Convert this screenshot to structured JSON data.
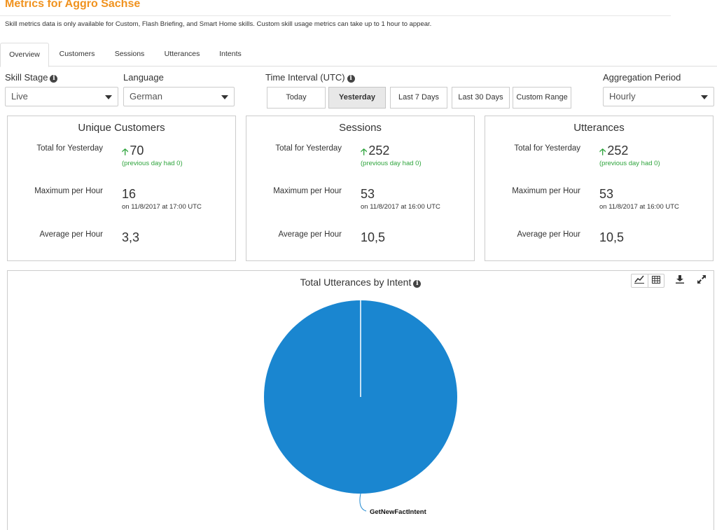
{
  "header": {
    "title": "Metrics for Aggro Sachse",
    "notice": "Skill metrics data is only available for Custom, Flash Briefing, and Smart Home skills. Custom skill usage metrics can take up to 1 hour to appear."
  },
  "tabs": [
    {
      "label": "Overview",
      "active": true
    },
    {
      "label": "Customers",
      "active": false
    },
    {
      "label": "Sessions",
      "active": false
    },
    {
      "label": "Utterances",
      "active": false
    },
    {
      "label": "Intents",
      "active": false
    }
  ],
  "controls": {
    "skill_stage": {
      "label": "Skill Stage",
      "value": "Live"
    },
    "language": {
      "label": "Language",
      "value": "German"
    },
    "time_interval": {
      "label": "Time Interval (UTC)",
      "options": [
        "Today",
        "Yesterday",
        "Last 7 Days",
        "Last 30 Days",
        "Custom Range"
      ],
      "selected": "Yesterday"
    },
    "aggregation": {
      "label": "Aggregation Period",
      "value": "Hourly"
    }
  },
  "cards": [
    {
      "title": "Unique Customers",
      "total_label": "Total for Yesterday",
      "total_value": "70",
      "total_sub": "(previous day had 0)",
      "max_label": "Maximum per Hour",
      "max_value": "16",
      "max_sub": "on 11/8/2017 at 17:00 UTC",
      "avg_label": "Average per Hour",
      "avg_value": "3,3"
    },
    {
      "title": "Sessions",
      "total_label": "Total for Yesterday",
      "total_value": "252",
      "total_sub": "(previous day had 0)",
      "max_label": "Maximum per Hour",
      "max_value": "53",
      "max_sub": "on 11/8/2017 at 16:00 UTC",
      "avg_label": "Average per Hour",
      "avg_value": "10,5"
    },
    {
      "title": "Utterances",
      "total_label": "Total for Yesterday",
      "total_value": "252",
      "total_sub": "(previous day had 0)",
      "max_label": "Maximum per Hour",
      "max_value": "53",
      "max_sub": "on 11/8/2017 at 16:00 UTC",
      "avg_label": "Average per Hour",
      "avg_value": "10,5"
    }
  ],
  "chart_panel": {
    "title": "Total Utterances by Intent",
    "tools": [
      "line-chart-icon",
      "table-icon",
      "download-icon",
      "expand-icon"
    ]
  },
  "chart_data": {
    "type": "pie",
    "title": "Total Utterances by Intent",
    "slices": [
      {
        "label": "GetNewFactIntent",
        "value": 100,
        "color": "#1a86d0"
      }
    ]
  },
  "colors": {
    "brand": "#f0921e",
    "positive": "#2ea43c",
    "pie": "#1a86d0"
  }
}
